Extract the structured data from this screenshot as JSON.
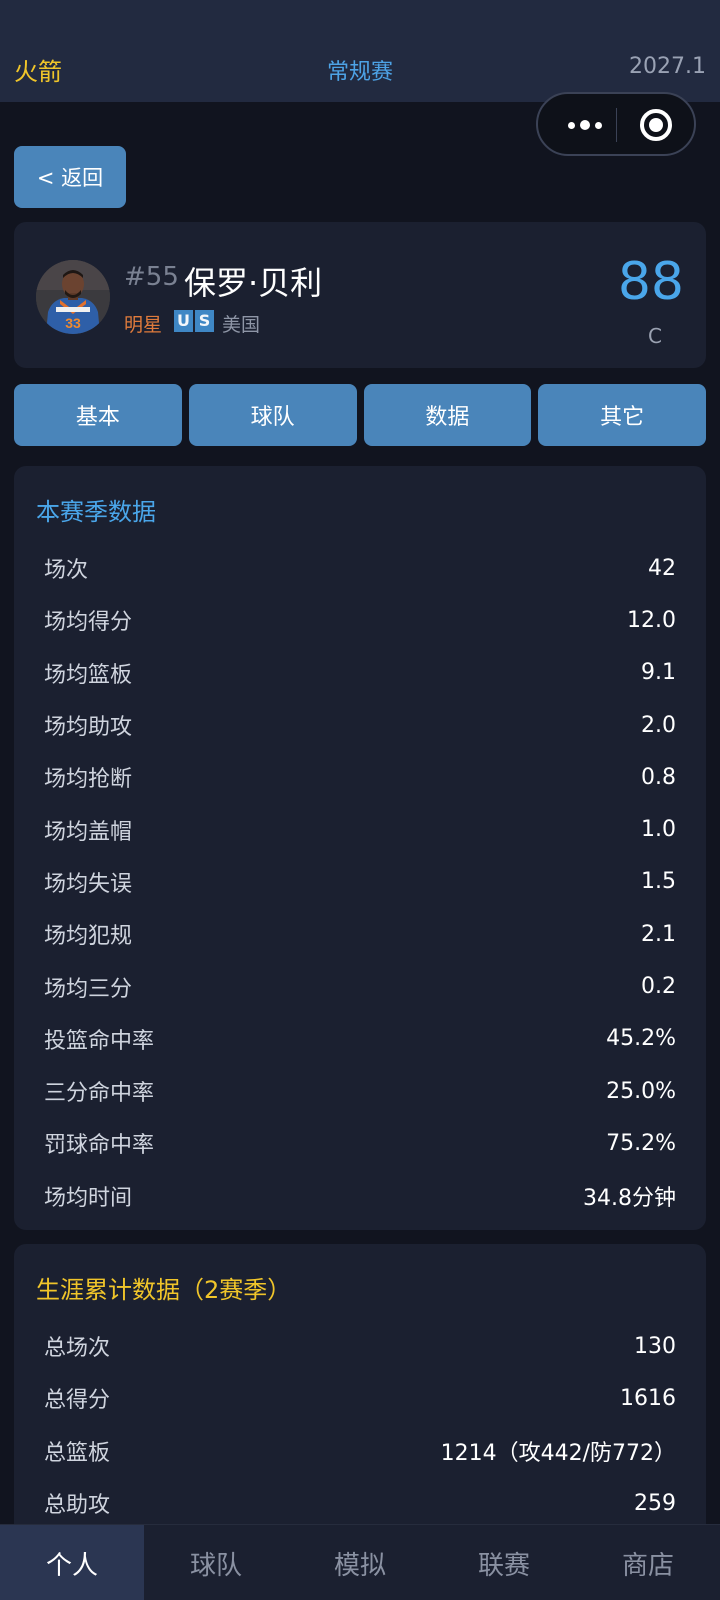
{
  "header": {
    "team": "火箭",
    "phase": "常规赛",
    "date": "2027.1"
  },
  "back_label": "< 返回",
  "player": {
    "number": "#55",
    "name": "保罗·贝利",
    "level": "明星",
    "flag_letters": [
      "U",
      "S"
    ],
    "country": "美国",
    "rating": "88",
    "position": "C",
    "jersey": "33"
  },
  "tabs": [
    "基本",
    "球队",
    "数据",
    "其它"
  ],
  "season": {
    "title": "本赛季数据",
    "rows": [
      {
        "label": "场次",
        "value": "42"
      },
      {
        "label": "场均得分",
        "value": "12.0"
      },
      {
        "label": "场均篮板",
        "value": "9.1"
      },
      {
        "label": "场均助攻",
        "value": "2.0"
      },
      {
        "label": "场均抢断",
        "value": "0.8"
      },
      {
        "label": "场均盖帽",
        "value": "1.0"
      },
      {
        "label": "场均失误",
        "value": "1.5"
      },
      {
        "label": "场均犯规",
        "value": "2.1"
      },
      {
        "label": "场均三分",
        "value": "0.2"
      },
      {
        "label": "投篮命中率",
        "value": "45.2%"
      },
      {
        "label": "三分命中率",
        "value": "25.0%"
      },
      {
        "label": "罚球命中率",
        "value": "75.2%"
      },
      {
        "label": "场均时间",
        "value": "34.8分钟"
      }
    ]
  },
  "career": {
    "title": "生涯累计数据（2赛季）",
    "rows": [
      {
        "label": "总场次",
        "value": "130"
      },
      {
        "label": "总得分",
        "value": "1616"
      },
      {
        "label": "总篮板",
        "value": "1214（攻442/防772）"
      },
      {
        "label": "总助攻",
        "value": "259"
      }
    ]
  },
  "bottom_nav": [
    "个人",
    "球队",
    "模拟",
    "联赛",
    "商店"
  ]
}
